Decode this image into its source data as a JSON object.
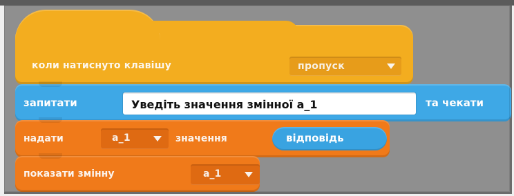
{
  "blocks": {
    "when_key_pressed": {
      "label": "коли натиснуто клавішу",
      "key": "пропуск"
    },
    "ask": {
      "label": "запитати",
      "prompt": "Уведіть значення змінної а_1",
      "wait": "та чекати"
    },
    "set": {
      "label": "надати",
      "variable": "а_1",
      "value_label": "значення",
      "reporter": "відповідь"
    },
    "show_variable": {
      "label": "показати змінну",
      "variable": "а_1"
    }
  },
  "colors": {
    "workspace": "#8f8f8f",
    "events": "#f3ad1f",
    "sensing": "#3ea8e6",
    "data": "#f07a1a"
  },
  "icons": {
    "dropdown": "chevron-down-icon"
  }
}
